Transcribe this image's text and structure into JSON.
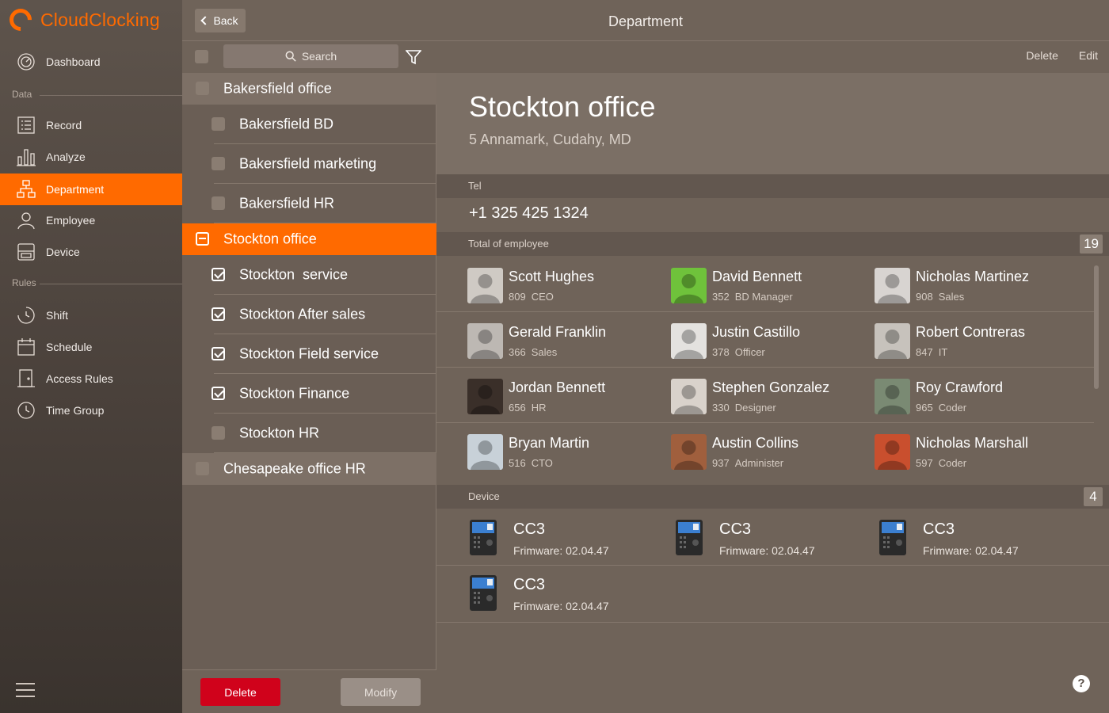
{
  "app": {
    "name": "CloudClocking",
    "brand_color": "#ff6a00"
  },
  "sidebar": {
    "items": [
      {
        "label": "Dashboard",
        "icon": "dashboard-icon"
      },
      {
        "label": "Record",
        "icon": "record-icon"
      },
      {
        "label": "Analyze",
        "icon": "analyze-icon"
      },
      {
        "label": "Department",
        "icon": "department-icon",
        "active": true
      },
      {
        "label": "Employee",
        "icon": "employee-icon"
      },
      {
        "label": "Device",
        "icon": "device-icon"
      },
      {
        "label": "Shift",
        "icon": "shift-icon"
      },
      {
        "label": "Schedule",
        "icon": "schedule-icon"
      },
      {
        "label": "Access Rules",
        "icon": "access-rules-icon"
      },
      {
        "label": "Time Group",
        "icon": "time-group-icon"
      }
    ],
    "sections": {
      "data": "Data",
      "rules": "Rules"
    }
  },
  "header": {
    "back_label": "Back",
    "title": "Department"
  },
  "list": {
    "search_placeholder": "Search",
    "rows": [
      {
        "label": "Bakersfield office",
        "level": "group",
        "state": "unchecked"
      },
      {
        "label": "Bakersfield BD",
        "level": "child",
        "state": "unchecked"
      },
      {
        "label": "Bakersfield marketing",
        "level": "child",
        "state": "unchecked"
      },
      {
        "label": "Bakersfield HR",
        "level": "child",
        "state": "unchecked"
      },
      {
        "label": "Stockton office",
        "level": "group",
        "state": "partial",
        "selected": true
      },
      {
        "label": "Stockton  service",
        "level": "child",
        "state": "checked"
      },
      {
        "label": "Stockton After sales",
        "level": "child",
        "state": "checked"
      },
      {
        "label": "Stockton Field service",
        "level": "child",
        "state": "checked"
      },
      {
        "label": "Stockton Finance",
        "level": "child",
        "state": "checked"
      },
      {
        "label": "Stockton HR",
        "level": "child",
        "state": "unchecked"
      },
      {
        "label": "Chesapeake office HR",
        "level": "group",
        "state": "unchecked"
      }
    ],
    "delete_label": "Delete",
    "modify_label": "Modify"
  },
  "detail": {
    "delete_label": "Delete",
    "edit_label": "Edit",
    "name": "Stockton office",
    "address": "5 Annamark, Cudahy, MD",
    "tel_label": "Tel",
    "tel": "+1 325 425 1324",
    "employees_label": "Total of employee",
    "employee_count": "19",
    "employees": [
      {
        "name": "Scott Hughes",
        "id": "809",
        "role": "CEO",
        "avatar_bg": "#cfcac4"
      },
      {
        "name": "David Bennett",
        "id": "352",
        "role": "BD Manager",
        "avatar_bg": "#6fc23b"
      },
      {
        "name": "Nicholas Martinez",
        "id": "908",
        "role": "Sales",
        "avatar_bg": "#d8d4d1"
      },
      {
        "name": "Gerald Franklin",
        "id": "366",
        "role": "Sales",
        "avatar_bg": "#bdb8b3"
      },
      {
        "name": "Justin Castillo",
        "id": "378",
        "role": "Officer",
        "avatar_bg": "#e4e2df"
      },
      {
        "name": "Robert Contreras",
        "id": "847",
        "role": "IT",
        "avatar_bg": "#c7c2bc"
      },
      {
        "name": "Jordan Bennett",
        "id": "656",
        "role": "HR",
        "avatar_bg": "#3a2f29"
      },
      {
        "name": "Stephen Gonzalez",
        "id": "330",
        "role": "Designer",
        "avatar_bg": "#d9d2cb"
      },
      {
        "name": "Roy Crawford",
        "id": "965",
        "role": "Coder",
        "avatar_bg": "#7a8a73"
      },
      {
        "name": "Bryan Martin",
        "id": "516",
        "role": "CTO",
        "avatar_bg": "#c8d1d8"
      },
      {
        "name": "Austin Collins",
        "id": "937",
        "role": "Administer",
        "avatar_bg": "#a05f3d"
      },
      {
        "name": "Nicholas Marshall",
        "id": "597",
        "role": "Coder",
        "avatar_bg": "#c94f2e"
      }
    ],
    "devices_label": "Device",
    "device_count": "4",
    "devices": [
      {
        "name": "CC3",
        "firmware": "Frimware: 02.04.47"
      },
      {
        "name": "CC3",
        "firmware": "Frimware: 02.04.47"
      },
      {
        "name": "CC3",
        "firmware": "Frimware: 02.04.47"
      },
      {
        "name": "CC3",
        "firmware": "Frimware: 02.04.47"
      }
    ],
    "help_label": "?"
  }
}
